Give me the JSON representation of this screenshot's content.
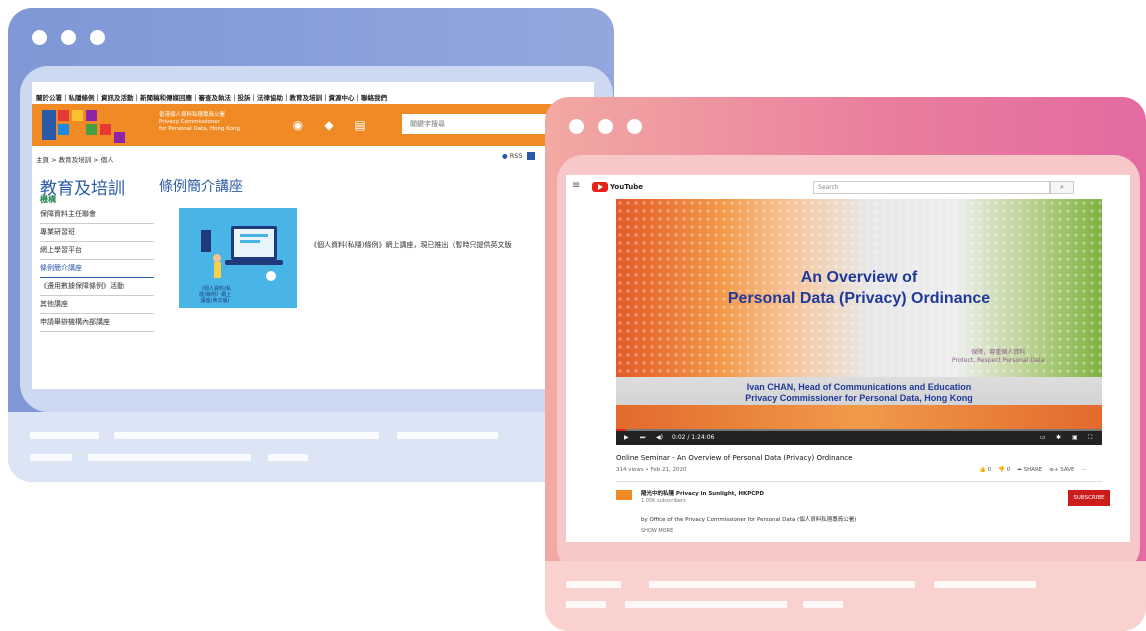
{
  "pcpd_page": {
    "top_nav": "關於公署｜私隱條例｜資訊及活動｜新聞稿和傳媒回應｜審查及執法｜投訴｜法律協助｜教育及培訓｜資源中心｜聯絡我們",
    "org_name_zh": "香港個人資料私隱專員公署",
    "org_name_en_1": "Privacy Commissioner",
    "org_name_en_2": "for Personal Data, Hong Kong",
    "search_placeholder": "關鍵字搜尋",
    "breadcrumb": "主頁 > 教育及培訓 > 個人",
    "rss_label": "RSS",
    "section_title": "教育及培訓",
    "section_subtitle": "機構",
    "side_nav": [
      "保障資料主任聯會",
      "專業研習班",
      "網上學習平台",
      "條例簡介講座",
      "《遵用數據保障條例》活動",
      "其他講座",
      "申請舉辦機構內部講座"
    ],
    "main_title": "條例簡介講座",
    "thumb_caption": "《個人資料(私隱)條例》網上講座(英文版)",
    "description": "《個人資料(私隱)條例》網上講座，現已推出（暫時只提供英文版"
  },
  "youtube": {
    "logo_text": "YouTube",
    "search_placeholder": "Search",
    "video_heading_line1": "An Overview of",
    "video_heading_line2": "Personal Data (Privacy) Ordinance",
    "slogan_zh": "保障，尊重個人資料",
    "slogan_en": "Protect, Respect Personal Data",
    "speaker_line1": "Ivan CHAN, Head of Communications and Education",
    "speaker_line2": "Privacy Commissioner for Personal Data, Hong Kong",
    "time": "0:02 / 1:24:06",
    "title": "Online Seminar - An Overview of Personal Data (Privacy) Ordinance",
    "meta": "314 views • Feb 21, 2020",
    "likes": "0",
    "dislikes": "0",
    "share": "SHARE",
    "save": "SAVE",
    "channel_name": "陽光中的私隱 Privacy in Sunlight, HKPCPD",
    "channel_subs": "1.05K subscribers",
    "subscribe": "SUBSCRIBE",
    "byline": "by Office of the Privacy Commissioner for Personal Data (個人資料私隱專員公署)",
    "show_more": "SHOW MORE"
  }
}
